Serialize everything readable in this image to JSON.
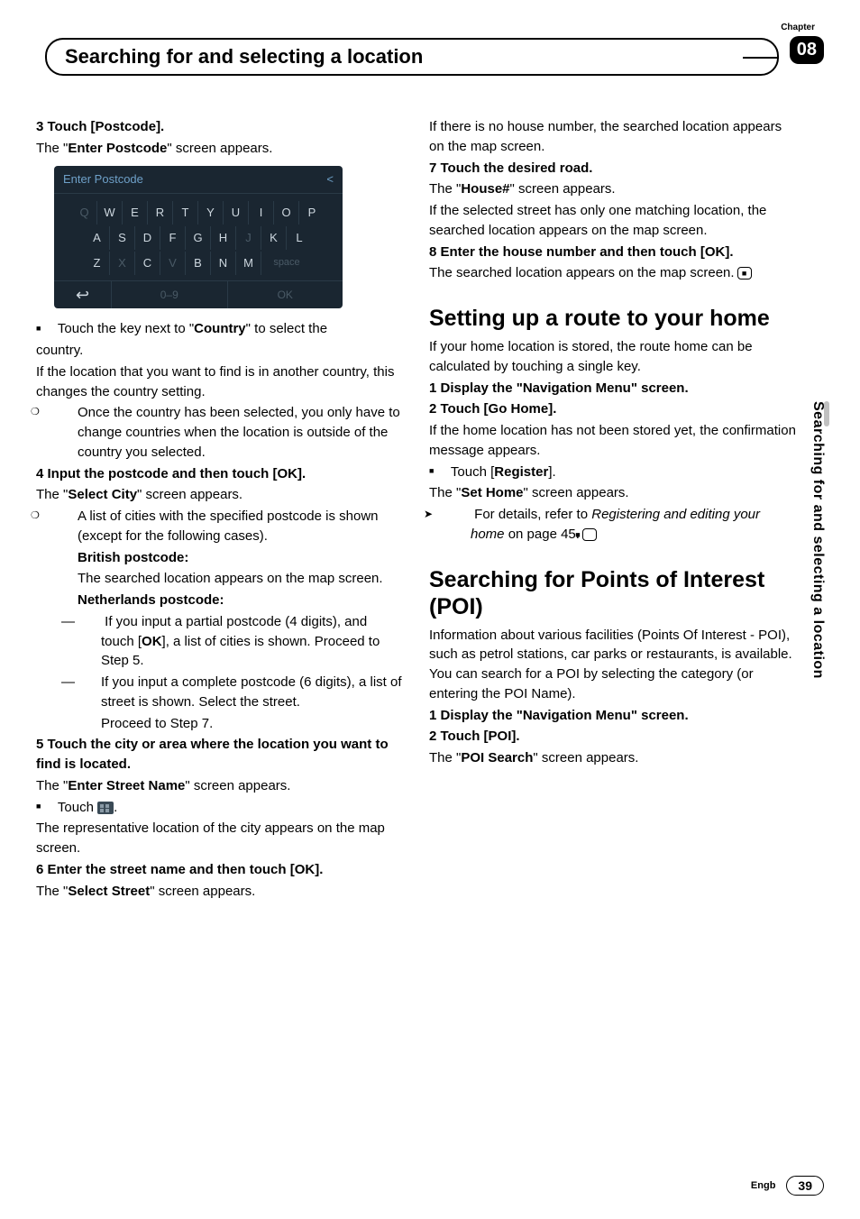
{
  "header": {
    "chapter_label": "Chapter",
    "chapter_num": "08",
    "title": "Searching for and selecting a location"
  },
  "side_tab": "Searching for and selecting a location",
  "keyboard": {
    "title": "Enter Postcode",
    "back_glyph": "<",
    "row1": [
      "Q",
      "W",
      "E",
      "R",
      "T",
      "Y",
      "U",
      "I",
      "O",
      "P"
    ],
    "row2": [
      "A",
      "S",
      "D",
      "F",
      "G",
      "H",
      "J",
      "K",
      "L"
    ],
    "row3": [
      "Z",
      "X",
      "C",
      "V",
      "B",
      "N",
      "M",
      "space"
    ],
    "back_arrow": "↩",
    "num": "0–9",
    "ok": "OK"
  },
  "left": {
    "s3_head": "3    Touch [Postcode].",
    "s3_p1a": "The \"",
    "s3_p1b": "Enter Postcode",
    "s3_p1c": "\" screen appears.",
    "b1a": "Touch the key next to \"",
    "b1b": "Country",
    "b1c": "\" to select the",
    "b1d": "country.",
    "p2": "If the location that you want to find is in another country, this changes the country setting.",
    "o1": "Once the country has been selected, you only have to change countries when the location is outside of the country you selected.",
    "s4_head": "4    Input the postcode and then touch [OK].",
    "s4_p1a": "The \"",
    "s4_p1b": "Select City",
    "s4_p1c": "\" screen appears.",
    "o2": "A list of cities with the specified postcode is shown (except for the following cases).",
    "bp_h": "British postcode:",
    "bp_t": "The searched location appears on the map screen.",
    "np_h": "Netherlands postcode:",
    "np_d1a": "If you input a partial postcode (4 digits), and touch [",
    "np_d1b": "OK",
    "np_d1c": "], a list of cities is shown. Proceed to Step 5.",
    "np_d2": "If you input a complete postcode (6 digits), a list of street is shown. Select the street.",
    "np_d2b": "Proceed to Step 7.",
    "s5_head": "5    Touch the city or area where the location you want to find is located.",
    "s5_p1a": "The \"",
    "s5_p1b": "Enter Street Name",
    "s5_p1c": "\" screen appears.",
    "s5_b": "Touch ",
    "s5_b2": ".",
    "s5_p2": "The representative location of the city appears on the map screen.",
    "s6_head": "6    Enter the street name and then touch [OK].",
    "s6_p1a": "The \"",
    "s6_p1b": "Select Street",
    "s6_p1c": "\" screen appears."
  },
  "right": {
    "p1": "If there is no house number, the searched location appears on the map screen.",
    "s7_head": "7    Touch the desired road.",
    "s7_p1a": "The \"",
    "s7_p1b": "House#",
    "s7_p1c": "\" screen appears.",
    "s7_p2": "If the selected street has only one matching location, the searched location appears on the map screen.",
    "s8_head": "8    Enter the house number and then touch [OK].",
    "s8_p1": "The searched location appears on the map screen.",
    "h2a": "Setting up a route to your home",
    "h2a_p": "If your home location is stored, the route home can be calculated by touching a single key.",
    "h2a_s1": "1    Display the \"Navigation Menu\" screen.",
    "h2a_s2": "2    Touch [Go Home].",
    "h2a_p2": "If the home location has not been stored yet, the confirmation message appears.",
    "h2a_b1a": "Touch [",
    "h2a_b1b": "Register",
    "h2a_b1c": "].",
    "h2a_p3a": "The \"",
    "h2a_p3b": "Set Home",
    "h2a_p3c": "\" screen appears.",
    "h2a_ref1": "For details, refer to ",
    "h2a_ref2": "Registering and editing your home",
    "h2a_ref3": " on page 45.",
    "h2b": "Searching for Points of Interest (POI)",
    "h2b_p": "Information about various facilities (Points Of Interest - POI), such as petrol stations, car parks or restaurants, is available. You can search for a POI by selecting the category (or entering the POI Name).",
    "h2b_s1": "1    Display the \"Navigation Menu\" screen.",
    "h2b_s2": "2    Touch [POI].",
    "h2b_p2a": "The \"",
    "h2b_p2b": "POI Search",
    "h2b_p2c": "\" screen appears."
  },
  "footer": {
    "lang": "Engb",
    "page": "39"
  }
}
